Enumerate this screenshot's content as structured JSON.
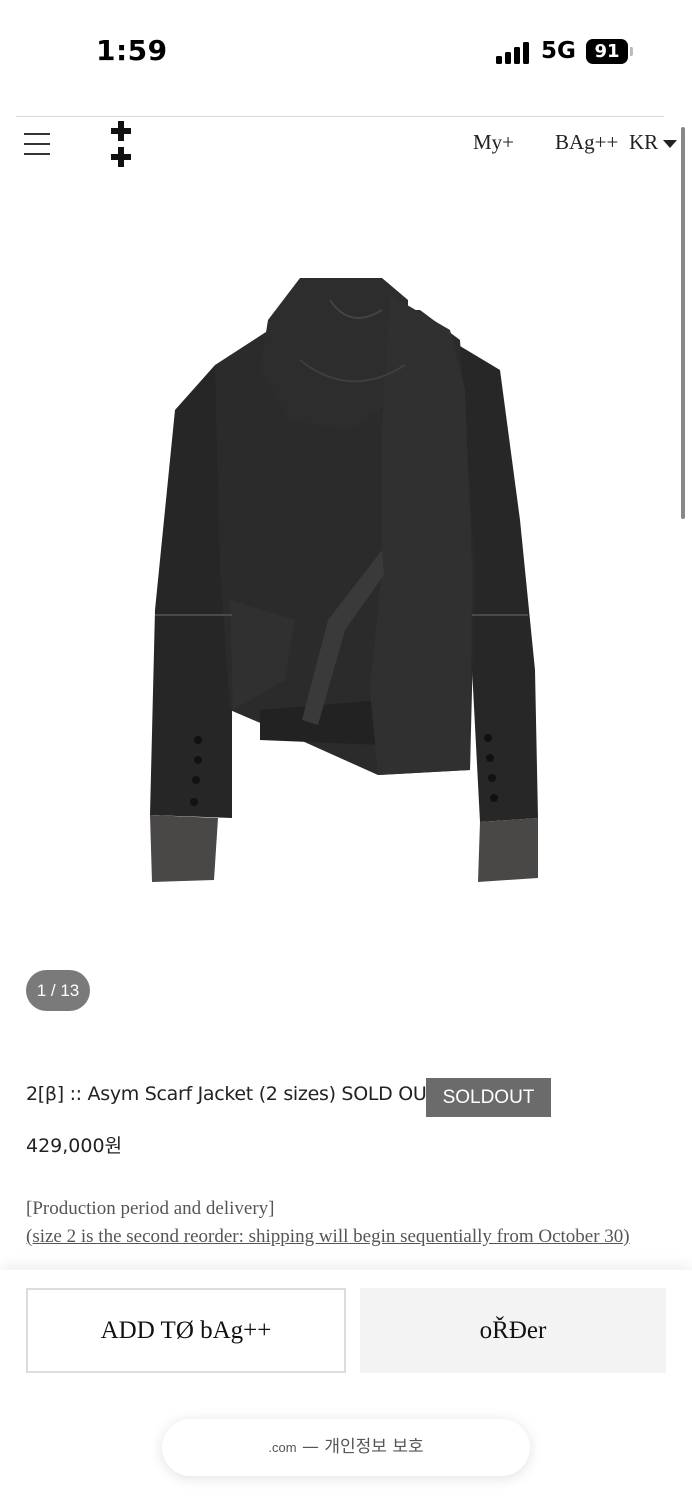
{
  "status_bar": {
    "time": "1:59",
    "network": "5G",
    "battery": "91"
  },
  "header": {
    "nav_my": "My+",
    "nav_bag": "BAg++",
    "nav_lang": "KR"
  },
  "gallery": {
    "counter": "1 / 13"
  },
  "product": {
    "name": "2[β] :: Asym Scarf Jacket (2 sizes) SOLD OUT",
    "badge": "SOLDOUT",
    "price": "429,000원",
    "production_heading": "[Production period and delivery]",
    "production_note": "(size 2 is the second reorder: shipping will begin sequentially from October 30)"
  },
  "actions": {
    "add_to_bag": "ADD TØ bAg++",
    "order": "oŘĐer"
  },
  "footer": {
    "domain": ".com",
    "privacy": " — 개인정보 보호"
  }
}
